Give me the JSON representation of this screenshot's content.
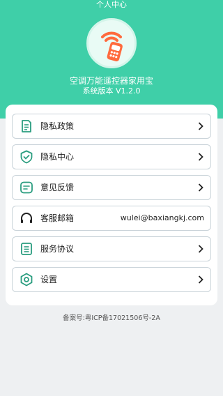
{
  "header": {
    "title": "个人中心",
    "app_name": "空调万能遥控器家用宝",
    "version_text": "系统版本  V1.2.0",
    "bg_color": "#3fcfa8"
  },
  "menu": {
    "items": [
      {
        "label": "隐私政策",
        "icon": "document-icon",
        "value": ""
      },
      {
        "label": "隐私中心",
        "icon": "shield-check-icon",
        "value": ""
      },
      {
        "label": "意见反馈",
        "icon": "message-icon",
        "value": ""
      },
      {
        "label": "客服邮箱",
        "icon": "headset-icon",
        "value": "wulei@baxiangkj.com"
      },
      {
        "label": "服务协议",
        "icon": "list-doc-icon",
        "value": ""
      },
      {
        "label": "设置",
        "icon": "hexagon-settings-icon",
        "value": ""
      }
    ]
  },
  "footer": {
    "record_text": "备案号:粤ICP备17021506号-2A"
  },
  "colors": {
    "accent": "#3fcfa8",
    "icon_green": "#2a9d7f",
    "logo_orange": "#ff6a3d"
  }
}
